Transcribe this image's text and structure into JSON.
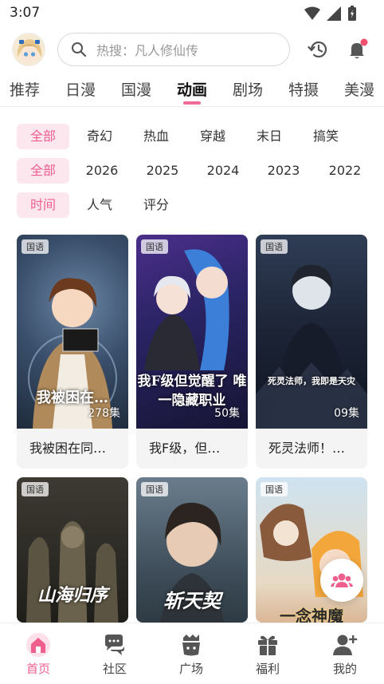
{
  "status": {
    "time": "3:07"
  },
  "search": {
    "placeholder": "热搜：凡人修仙传"
  },
  "tabs": [
    {
      "label": "推荐"
    },
    {
      "label": "日漫"
    },
    {
      "label": "国漫"
    },
    {
      "label": "动画",
      "active": true
    },
    {
      "label": "剧场"
    },
    {
      "label": "特摄"
    },
    {
      "label": "美漫"
    }
  ],
  "filters": {
    "genre": [
      "全部",
      "奇幻",
      "热血",
      "穿越",
      "末日",
      "搞笑"
    ],
    "year": [
      "全部",
      "2026",
      "2025",
      "2024",
      "2023",
      "2022"
    ],
    "sort": [
      "时间",
      "人气",
      "评分"
    ]
  },
  "cards": [
    {
      "badge": "国语",
      "episodes": "278集",
      "title": "我被困在同…",
      "cover_text": "我被困在…"
    },
    {
      "badge": "国语",
      "episodes": "50集",
      "title": "我F级，但…",
      "cover_text": "我F级但觉醒了 唯一隐藏职业"
    },
    {
      "badge": "国语",
      "episodes": "09集",
      "title": "死灵法师！…",
      "cover_text": "死灵法师，我即是天灾"
    },
    {
      "badge": "国语",
      "cover_text": "山海归序"
    },
    {
      "badge": "国语",
      "cover_text": "斩天契"
    },
    {
      "badge": "国语",
      "cover_text": "一念神魔"
    }
  ],
  "bottom_nav": [
    {
      "label": "首页",
      "icon": "home-icon",
      "active": true
    },
    {
      "label": "社区",
      "icon": "chat-bubbles-icon"
    },
    {
      "label": "广场",
      "icon": "plaza-icon"
    },
    {
      "label": "福利",
      "icon": "gift-icon"
    },
    {
      "label": "我的",
      "icon": "profile-icon"
    }
  ],
  "colors": {
    "accent": "#ef5f8e",
    "chip_bg": "#fde7ee"
  }
}
